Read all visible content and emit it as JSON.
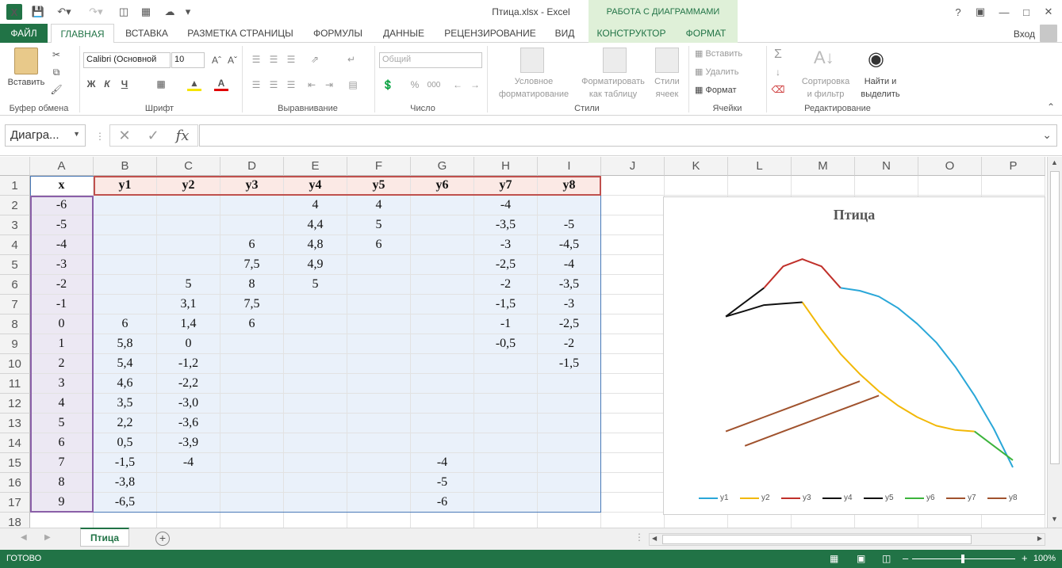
{
  "app": {
    "logo": "X",
    "doc_title": "Птица.xlsx - Excel",
    "context_group": "РАБОТА С ДИАГРАММАМИ",
    "login": "Вход",
    "help": "?"
  },
  "tabs": [
    "ФАЙЛ",
    "ГЛАВНАЯ",
    "ВСТАВКА",
    "РАЗМЕТКА СТРАНИЦЫ",
    "ФОРМУЛЫ",
    "ДАННЫЕ",
    "РЕЦЕНЗИРОВАНИЕ",
    "ВИД",
    "КОНСТРУКТОР",
    "ФОРМАТ"
  ],
  "ribbon": {
    "paste": "Вставить",
    "clipboard_group": "Буфер обмена",
    "font_name": "Calibri (Основной",
    "font_size": "10",
    "bold": "Ж",
    "italic": "К",
    "underline": "Ч",
    "font_group": "Шрифт",
    "align_group": "Выравнивание",
    "number_format": "Общий",
    "number_group": "Число",
    "percent": "%",
    "thousands": "000",
    "cond_format_1": "Условное",
    "cond_format_2": "форматирование",
    "format_table_1": "Форматировать",
    "format_table_2": "как таблицу",
    "cell_styles_1": "Стили",
    "cell_styles_2": "ячеек",
    "styles_group": "Стили",
    "insert": "Вставить",
    "delete": "Удалить",
    "format": "Формат",
    "cells_group": "Ячейки",
    "sort_1": "Сортировка",
    "sort_2": "и фильтр",
    "find_1": "Найти и",
    "find_2": "выделить",
    "editing_group": "Редактирование"
  },
  "formula_bar": {
    "name_box": "Диагра...",
    "fx": "fx",
    "formula": ""
  },
  "grid": {
    "columns": [
      "A",
      "B",
      "C",
      "D",
      "E",
      "F",
      "G",
      "H",
      "I",
      "J",
      "K",
      "L",
      "M",
      "N",
      "O",
      "P"
    ],
    "rows": [
      "1",
      "2",
      "3",
      "4",
      "5",
      "6",
      "7",
      "8",
      "9",
      "10",
      "11",
      "12",
      "13",
      "14",
      "15",
      "16",
      "17",
      "18"
    ],
    "cells": [
      [
        "x",
        "y1",
        "y2",
        "y3",
        "y4",
        "y5",
        "y6",
        "y7",
        "y8"
      ],
      [
        "-6",
        "",
        "",
        "",
        "4",
        "4",
        "",
        "-4",
        ""
      ],
      [
        "-5",
        "",
        "",
        "",
        "4,4",
        "5",
        "",
        "-3,5",
        "-5"
      ],
      [
        "-4",
        "",
        "",
        "6",
        "4,8",
        "6",
        "",
        "-3",
        "-4,5"
      ],
      [
        "-3",
        "",
        "",
        "7,5",
        "4,9",
        "",
        "",
        "-2,5",
        "-4"
      ],
      [
        "-2",
        "",
        "5",
        "8",
        "5",
        "",
        "",
        "-2",
        "-3,5"
      ],
      [
        "-1",
        "",
        "3,1",
        "7,5",
        "",
        "",
        "",
        "-1,5",
        "-3"
      ],
      [
        "0",
        "6",
        "1,4",
        "6",
        "",
        "",
        "",
        "-1",
        "-2,5"
      ],
      [
        "1",
        "5,8",
        "0",
        "",
        "",
        "",
        "",
        "-0,5",
        "-2"
      ],
      [
        "2",
        "5,4",
        "-1,2",
        "",
        "",
        "",
        "",
        "",
        "-1,5"
      ],
      [
        "3",
        "4,6",
        "-2,2",
        "",
        "",
        "",
        "",
        "",
        ""
      ],
      [
        "4",
        "3,5",
        "-3,0",
        "",
        "",
        "",
        "",
        "",
        ""
      ],
      [
        "5",
        "2,2",
        "-3,6",
        "",
        "",
        "",
        "",
        "",
        ""
      ],
      [
        "6",
        "0,5",
        "-3,9",
        "",
        "",
        "",
        "",
        "",
        ""
      ],
      [
        "7",
        "-1,5",
        "-4",
        "",
        "",
        "",
        "-4",
        "",
        ""
      ],
      [
        "8",
        "-3,8",
        "",
        "",
        "",
        "",
        "-5",
        "",
        ""
      ],
      [
        "9",
        "-6,5",
        "",
        "",
        "",
        "",
        "-6",
        "",
        ""
      ]
    ]
  },
  "chart_data": {
    "type": "line",
    "title": "Птица",
    "x": [
      -6,
      -5,
      -4,
      -3,
      -2,
      -1,
      0,
      1,
      2,
      3,
      4,
      5,
      6,
      7,
      8,
      9
    ],
    "series": [
      {
        "name": "y1",
        "color": "#2aa7d8",
        "values": [
          null,
          null,
          null,
          null,
          null,
          null,
          6,
          5.8,
          5.4,
          4.6,
          3.5,
          2.2,
          0.5,
          -1.5,
          -3.8,
          -6.5
        ]
      },
      {
        "name": "y2",
        "color": "#f2b807",
        "values": [
          null,
          null,
          null,
          null,
          5,
          3.1,
          1.4,
          0,
          -1.2,
          -2.2,
          -3.0,
          -3.6,
          -3.9,
          -4,
          null,
          null
        ]
      },
      {
        "name": "y3",
        "color": "#c0302a",
        "values": [
          null,
          null,
          6,
          7.5,
          8,
          7.5,
          6,
          null,
          null,
          null,
          null,
          null,
          null,
          null,
          null,
          null
        ]
      },
      {
        "name": "y4",
        "color": "#111111",
        "values": [
          4,
          4.4,
          4.8,
          4.9,
          5,
          null,
          null,
          null,
          null,
          null,
          null,
          null,
          null,
          null,
          null,
          null
        ]
      },
      {
        "name": "y5",
        "color": "#111111",
        "values": [
          4,
          5,
          6,
          null,
          null,
          null,
          null,
          null,
          null,
          null,
          null,
          null,
          null,
          null,
          null,
          null
        ]
      },
      {
        "name": "y6",
        "color": "#3cb43c",
        "values": [
          null,
          null,
          null,
          null,
          null,
          null,
          null,
          null,
          null,
          null,
          null,
          null,
          null,
          -4,
          -5,
          -6
        ]
      },
      {
        "name": "y7",
        "color": "#a0522d",
        "values": [
          -4,
          -3.5,
          -3,
          -2.5,
          -2,
          -1.5,
          -1,
          -0.5,
          null,
          null,
          null,
          null,
          null,
          null,
          null,
          null
        ]
      },
      {
        "name": "y8",
        "color": "#a0522d",
        "values": [
          null,
          -5,
          -4.5,
          -4,
          -3.5,
          -3,
          -2.5,
          -2,
          -1.5,
          null,
          null,
          null,
          null,
          null,
          null,
          null
        ]
      }
    ],
    "grid": false,
    "legend": "bottom"
  },
  "sheets": {
    "active": "Птица",
    "add": "+"
  },
  "status": {
    "text": "ГОТОВО",
    "zoom": "100%"
  }
}
